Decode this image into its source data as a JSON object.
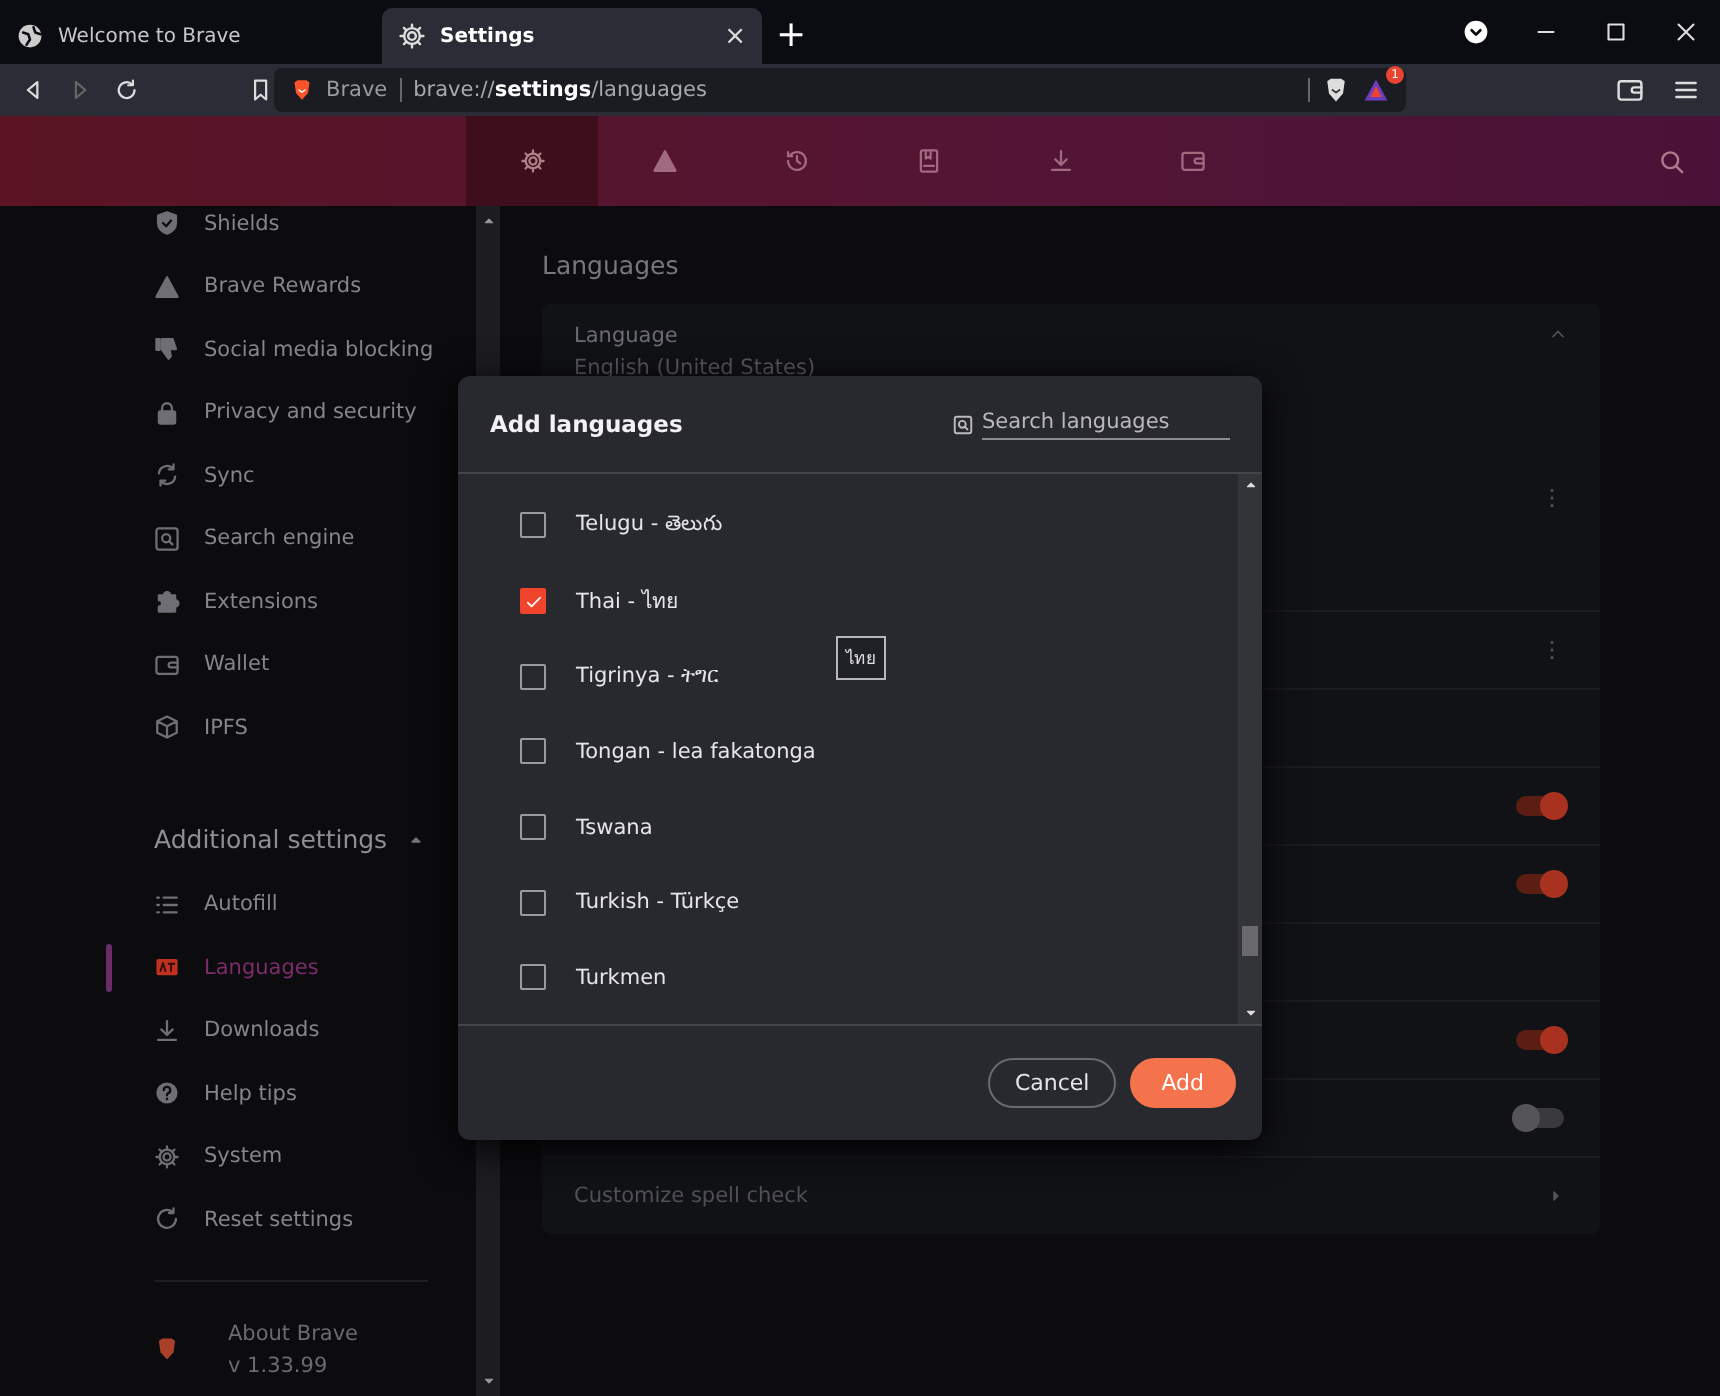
{
  "tabs": [
    {
      "title": "Welcome to Brave",
      "kind": "globe",
      "selected": false
    },
    {
      "title": "Settings",
      "kind": "gear",
      "selected": true,
      "close_label": "×"
    }
  ],
  "new_tab": "+",
  "toolbar": {
    "back_disabled": false,
    "forward_disabled": true,
    "site_label": "Brave",
    "url": "brave://**settings**/languages",
    "rewards_badge": "1"
  },
  "header_nav": [
    {
      "kind": "gear",
      "selected": true
    },
    {
      "kind": "triangle",
      "selected": false
    },
    {
      "kind": "history",
      "selected": false
    },
    {
      "kind": "bookmark",
      "selected": false
    },
    {
      "kind": "download",
      "selected": false
    },
    {
      "kind": "wallet",
      "selected": false
    }
  ],
  "sidebar": {
    "items": [
      {
        "label": "Shields",
        "kind": "shield",
        "selected": false
      },
      {
        "label": "Brave Rewards",
        "kind": "triangle",
        "selected": false
      },
      {
        "label": "Social media blocking",
        "kind": "thumbsdown",
        "selected": false
      },
      {
        "label": "Privacy and security",
        "kind": "lock",
        "selected": false
      },
      {
        "label": "Sync",
        "kind": "sync",
        "selected": false
      },
      {
        "label": "Search engine",
        "kind": "search",
        "selected": false
      },
      {
        "label": "Extensions",
        "kind": "puzzle",
        "selected": false
      },
      {
        "label": "Wallet",
        "kind": "wallet",
        "selected": false
      },
      {
        "label": "IPFS",
        "kind": "cube",
        "selected": false
      }
    ],
    "additional": {
      "title": "Additional settings",
      "expanded": true,
      "items": [
        {
          "label": "Autofill",
          "kind": "list",
          "selected": false
        },
        {
          "label": "Languages",
          "kind": "language",
          "selected": true
        },
        {
          "label": "Downloads",
          "kind": "download",
          "selected": false
        },
        {
          "label": "Help tips",
          "kind": "help",
          "selected": false
        },
        {
          "label": "System",
          "kind": "gear",
          "selected": false
        },
        {
          "label": "Reset settings",
          "kind": "reset",
          "selected": false
        }
      ]
    },
    "about": {
      "title": "About Brave",
      "version": "v 1.33.99"
    }
  },
  "main": {
    "section_title": "Languages",
    "language_card": {
      "label": "Language",
      "value": "English (United States)",
      "expanded": true
    },
    "rows": [
      {
        "kind": "menu"
      },
      {
        "kind": "menu"
      },
      {
        "kind": "blank"
      },
      {
        "kind": "toggle",
        "on": true
      },
      {
        "kind": "toggle",
        "on": true
      },
      {
        "kind": "blank"
      },
      {
        "kind": "toggle",
        "on": true
      },
      {
        "kind": "toggle",
        "on": false
      }
    ],
    "spell_check": "Customize spell check"
  },
  "dialog": {
    "title": "Add languages",
    "search": {
      "placeholder": "Search languages"
    },
    "languages": [
      {
        "label": "Telugu - తెలుగు",
        "checked": false
      },
      {
        "label": "Thai - ไทย",
        "checked": true
      },
      {
        "label": "Tigrinya - ትግር",
        "checked": false
      },
      {
        "label": "Tongan - lea fakatonga",
        "checked": false
      },
      {
        "label": "Tswana",
        "checked": false
      },
      {
        "label": "Turkish - Türkçe",
        "checked": false
      },
      {
        "label": "Turkmen",
        "checked": false
      }
    ],
    "tooltip": "ไทย",
    "buttons": [
      {
        "label": "Cancel",
        "kind": "secondary"
      },
      {
        "label": "Add",
        "kind": "primary"
      }
    ]
  }
}
